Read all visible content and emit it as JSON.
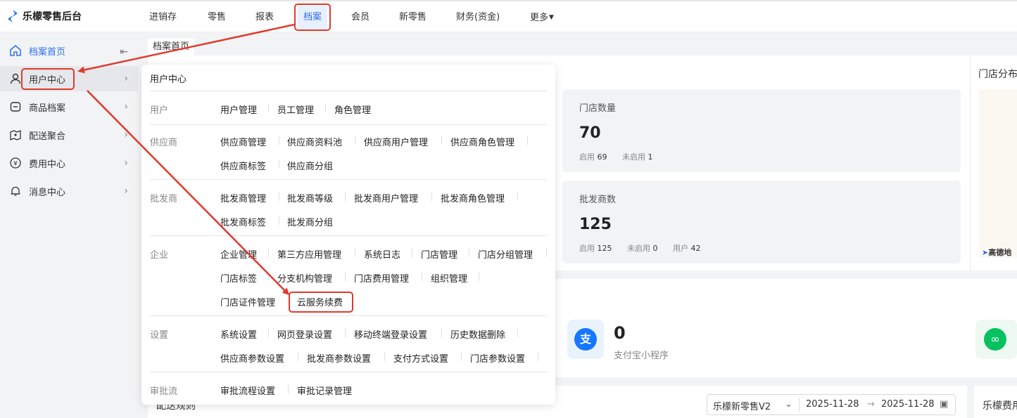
{
  "app": {
    "title": "乐檬零售后台"
  },
  "topnav": {
    "items": [
      {
        "label": "进销存"
      },
      {
        "label": "零售"
      },
      {
        "label": "报表"
      },
      {
        "label": "档案"
      },
      {
        "label": "会员"
      },
      {
        "label": "新零售"
      },
      {
        "label": "财务(资金)"
      },
      {
        "label": "更多"
      }
    ],
    "active_index": 3
  },
  "sidebar": {
    "items": [
      {
        "label": "档案首页",
        "icon": "home-icon"
      },
      {
        "label": "用户中心",
        "icon": "user-icon"
      },
      {
        "label": "商品档案",
        "icon": "box-icon"
      },
      {
        "label": "配送聚合",
        "icon": "delivery-icon"
      },
      {
        "label": "费用中心",
        "icon": "yen-icon"
      },
      {
        "label": "消息中心",
        "icon": "bell-icon"
      }
    ]
  },
  "tabs": {
    "home": "档案首页"
  },
  "dropdown": {
    "title": "用户中心",
    "groups": [
      {
        "label": "用户",
        "links": [
          "用户管理",
          "员工管理",
          "角色管理"
        ]
      },
      {
        "label": "供应商",
        "links": [
          "供应商管理",
          "供应商资料池",
          "供应商用户管理",
          "供应商角色管理",
          "供应商标签",
          "供应商分组"
        ]
      },
      {
        "label": "批发商",
        "links": [
          "批发商管理",
          "批发商等级",
          "批发商用户管理",
          "批发商角色管理",
          "批发商标签",
          "批发商分组"
        ]
      },
      {
        "label": "企业",
        "links": [
          "企业管理",
          "第三方应用管理",
          "系统日志",
          "门店管理",
          "门店分组管理",
          "门店标签",
          "分支机构管理",
          "门店费用管理",
          "组织管理",
          "门店证件管理",
          "云服务续费"
        ]
      },
      {
        "label": "设置",
        "links": [
          "系统设置",
          "网页登录设置",
          "移动终端登录设置",
          "历史数据删除",
          "供应商参数设置",
          "批发商参数设置",
          "支付方式设置",
          "门店参数设置"
        ]
      },
      {
        "label": "审批流",
        "links": [
          "审批流程设置",
          "审批记录管理"
        ]
      }
    ]
  },
  "stats": {
    "stores": {
      "title": "门店数量",
      "value": "70",
      "enabled_label": "启用",
      "enabled": "69",
      "disabled_label": "未启用",
      "disabled": "1"
    },
    "wholesalers": {
      "title": "批发商数",
      "value": "125",
      "enabled_label": "启用",
      "enabled": "125",
      "disabled_label": "未启用",
      "disabled": "0",
      "users_label": "用户",
      "users": "42"
    }
  },
  "right_panel": {
    "title": "门店分布",
    "map_brand": "高德地"
  },
  "alipay": {
    "value": "0",
    "label": "支付宝小程序"
  },
  "bottom": {
    "rule_title": "配送规则",
    "product": "乐檬新零售V2",
    "date_from": "2025-11-28",
    "date_to": "2025-11-28",
    "right_title": "乐檬费用"
  },
  "colors": {
    "accent": "#2f6fed",
    "highlight": "#e03a2c"
  }
}
